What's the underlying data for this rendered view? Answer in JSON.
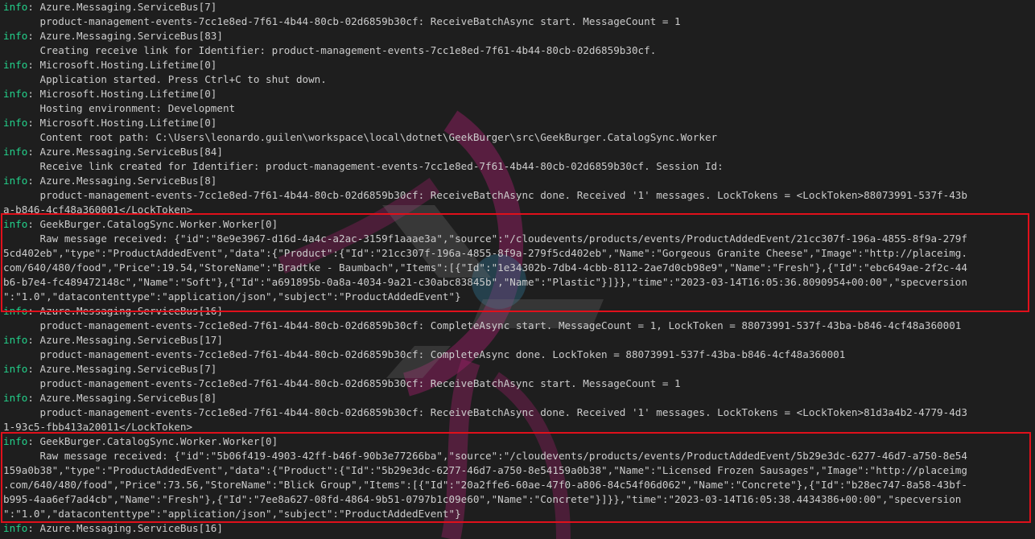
{
  "terminal": {
    "lines": [
      {
        "level": "info",
        "text": ": Azure.Messaging.ServiceBus[7]"
      },
      {
        "text": "      product-management-events-7cc1e8ed-7f61-4b44-80cb-02d6859b30cf: ReceiveBatchAsync start. MessageCount = 1"
      },
      {
        "level": "info",
        "text": ": Azure.Messaging.ServiceBus[83]"
      },
      {
        "text": "      Creating receive link for Identifier: product-management-events-7cc1e8ed-7f61-4b44-80cb-02d6859b30cf."
      },
      {
        "level": "info",
        "text": ": Microsoft.Hosting.Lifetime[0]"
      },
      {
        "text": "      Application started. Press Ctrl+C to shut down."
      },
      {
        "level": "info",
        "text": ": Microsoft.Hosting.Lifetime[0]"
      },
      {
        "text": "      Hosting environment: Development"
      },
      {
        "level": "info",
        "text": ": Microsoft.Hosting.Lifetime[0]"
      },
      {
        "text": "      Content root path: C:\\Users\\leonardo.guilen\\workspace\\local\\dotnet\\GeekBurger\\src\\GeekBurger.CatalogSync.Worker"
      },
      {
        "level": "info",
        "text": ": Azure.Messaging.ServiceBus[84]"
      },
      {
        "text": "      Receive link created for Identifier: product-management-events-7cc1e8ed-7f61-4b44-80cb-02d6859b30cf. Session Id:"
      },
      {
        "level": "info",
        "text": ": Azure.Messaging.ServiceBus[8]"
      },
      {
        "text": "      product-management-events-7cc1e8ed-7f61-4b44-80cb-02d6859b30cf: ReceiveBatchAsync done. Received '1' messages. LockTokens = <LockToken>88073991-537f-43b"
      },
      {
        "text": "a-b846-4cf48a360001</LockToken>"
      },
      {
        "level": "info",
        "text": ": GeekBurger.CatalogSync.Worker.Worker[0]"
      },
      {
        "text": "      Raw message received: {\"id\":\"8e9e3967-d16d-4a4c-a2ac-3159f1aaae3a\",\"source\":\"/cloudevents/products/events/ProductAddedEvent/21cc307f-196a-4855-8f9a-279f"
      },
      {
        "text": "5cd402eb\",\"type\":\"ProductAddedEvent\",\"data\":{\"Product\":{\"Id\":\"21cc307f-196a-4855-8f9a-279f5cd402eb\",\"Name\":\"Gorgeous Granite Cheese\",\"Image\":\"http://placeimg."
      },
      {
        "text": "com/640/480/food\",\"Price\":19.54,\"StoreName\":\"Bradtke - Baumbach\",\"Items\":[{\"Id\":\"1e34302b-7db4-4cbb-8112-2ae7d0cb98e9\",\"Name\":\"Fresh\"},{\"Id\":\"ebc649ae-2f2c-44"
      },
      {
        "text": "b6-b7e4-fc489472148c\",\"Name\":\"Soft\"},{\"Id\":\"a691895b-0a8a-4034-9a21-c30abc83845b\",\"Name\":\"Plastic\"}]}},\"time\":\"2023-03-14T16:05:36.8090954+00:00\",\"specversion"
      },
      {
        "text": "\":\"1.0\",\"datacontenttype\":\"application/json\",\"subject\":\"ProductAddedEvent\"}"
      },
      {
        "level": "info",
        "text": ": Azure.Messaging.ServiceBus[16]"
      },
      {
        "text": "      product-management-events-7cc1e8ed-7f61-4b44-80cb-02d6859b30cf: CompleteAsync start. MessageCount = 1, LockToken = 88073991-537f-43ba-b846-4cf48a360001"
      },
      {
        "level": "info",
        "text": ": Azure.Messaging.ServiceBus[17]"
      },
      {
        "text": "      product-management-events-7cc1e8ed-7f61-4b44-80cb-02d6859b30cf: CompleteAsync done. LockToken = 88073991-537f-43ba-b846-4cf48a360001"
      },
      {
        "level": "info",
        "text": ": Azure.Messaging.ServiceBus[7]"
      },
      {
        "text": "      product-management-events-7cc1e8ed-7f61-4b44-80cb-02d6859b30cf: ReceiveBatchAsync start. MessageCount = 1"
      },
      {
        "level": "info",
        "text": ": Azure.Messaging.ServiceBus[8]"
      },
      {
        "text": "      product-management-events-7cc1e8ed-7f61-4b44-80cb-02d6859b30cf: ReceiveBatchAsync done. Received '1' messages. LockTokens = <LockToken>81d3a4b2-4779-4d3"
      },
      {
        "text": "1-93c5-fbb413a20011</LockToken>"
      },
      {
        "level": "info",
        "text": ": GeekBurger.CatalogSync.Worker.Worker[0]"
      },
      {
        "text": "      Raw message received: {\"id\":\"5b06f419-4903-42ff-b46f-90b3e77266ba\",\"source\":\"/cloudevents/products/events/ProductAddedEvent/5b29e3dc-6277-46d7-a750-8e54"
      },
      {
        "text": "159a0b38\",\"type\":\"ProductAddedEvent\",\"data\":{\"Product\":{\"Id\":\"5b29e3dc-6277-46d7-a750-8e54159a0b38\",\"Name\":\"Licensed Frozen Sausages\",\"Image\":\"http://placeimg"
      },
      {
        "text": ".com/640/480/food\",\"Price\":73.56,\"StoreName\":\"Blick Group\",\"Items\":[{\"Id\":\"20a2ffe6-60ae-47f0-a806-84c54f06d062\",\"Name\":\"Concrete\"},{\"Id\":\"b28ec747-8a58-43bf-"
      },
      {
        "text": "b995-4aa6ef7ad4cb\",\"Name\":\"Fresh\"},{\"Id\":\"7ee8a627-08fd-4864-9b51-0797b1c09e60\",\"Name\":\"Concrete\"}]}},\"time\":\"2023-03-14T16:05:38.4434386+00:00\",\"specversion"
      },
      {
        "text": "\":\"1.0\",\"datacontenttype\":\"application/json\",\"subject\":\"ProductAddedEvent\"}"
      },
      {
        "level": "info",
        "text": ": Azure.Messaging.ServiceBus[16]"
      }
    ]
  },
  "colors": {
    "background": "#1e1e1e",
    "text": "#cccccc",
    "info_level": "#23d18b",
    "highlight_box": "#e0101b"
  }
}
